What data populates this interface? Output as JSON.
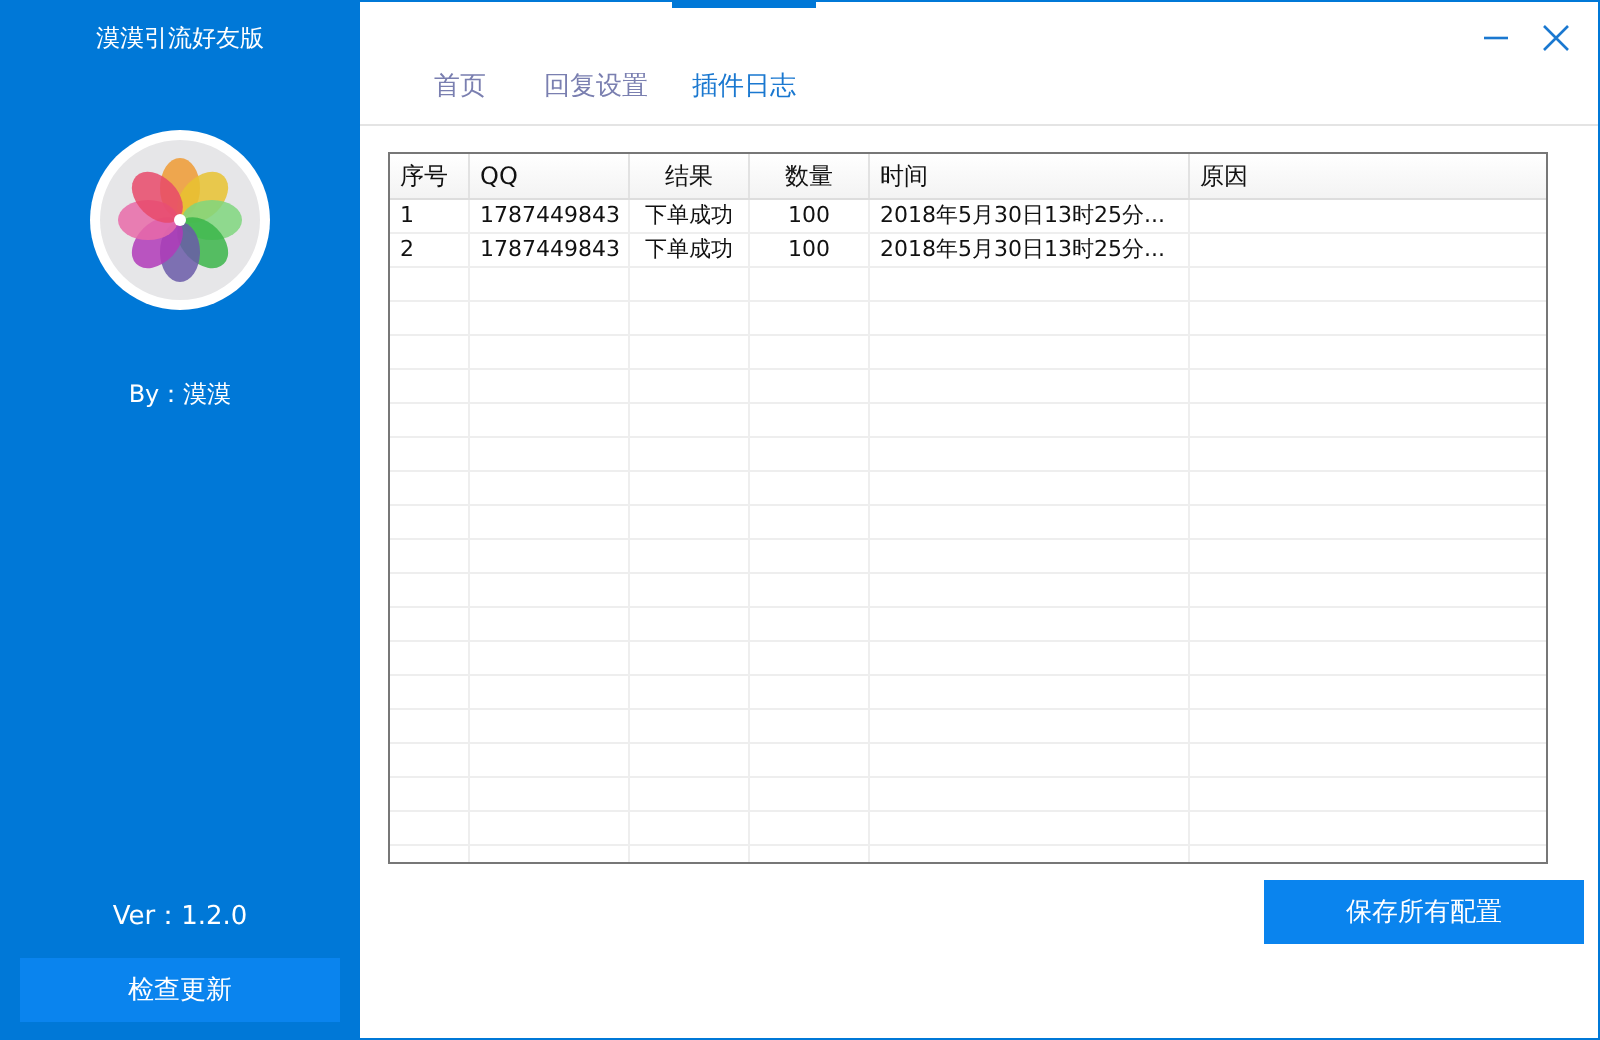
{
  "sidebar": {
    "title": "漠漠引流好友版",
    "author": "By：漠漠",
    "version": "Ver：1.2.0",
    "update_button": "检查更新"
  },
  "tabs": [
    {
      "label": "首页",
      "selected": false
    },
    {
      "label": "回复设置",
      "selected": false
    },
    {
      "label": "插件日志",
      "selected": true
    }
  ],
  "table": {
    "columns": [
      "序号",
      "QQ",
      "结果",
      "数量",
      "时间",
      "原因"
    ],
    "rows": [
      [
        "1",
        "1787449843",
        "下单成功",
        "100",
        "2018年5月30日13时25分...",
        ""
      ],
      [
        "2",
        "1787449843",
        "下单成功",
        "100",
        "2018年5月30日13时25分...",
        ""
      ]
    ]
  },
  "save_button": "保存所有配置"
}
